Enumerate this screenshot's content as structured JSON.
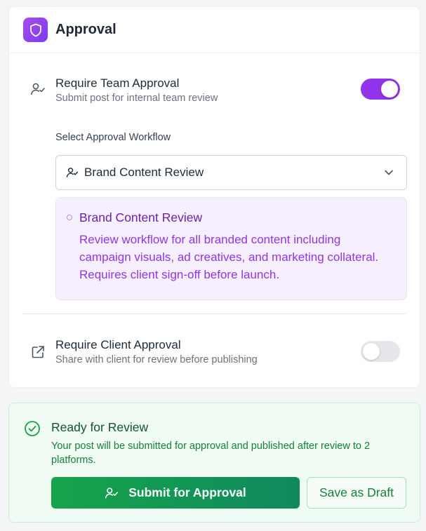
{
  "approval_card": {
    "title": "Approval",
    "team_approval": {
      "title": "Require Team Approval",
      "subtitle": "Submit post for internal team review",
      "enabled": true
    },
    "workflow": {
      "label": "Select Approval Workflow",
      "selected": "Brand Content Review",
      "info_title": "Brand Content Review",
      "info_description": "Review workflow for all branded content including campaign visuals, ad creatives, and marketing collateral. Requires client sign-off before launch."
    },
    "client_approval": {
      "title": "Require Client Approval",
      "subtitle": "Share with client for review before publishing",
      "enabled": false
    }
  },
  "ready_panel": {
    "title": "Ready for Review",
    "description": "Your post will be submitted for approval and published after review to 2 platforms.",
    "submit_label": "Submit for Approval",
    "draft_label": "Save as Draft"
  },
  "colors": {
    "accent_purple": "#9333ea",
    "success_green": "#16a34a"
  },
  "icons": {
    "header": "shield-icon",
    "team": "user-check-icon",
    "client": "external-link-icon",
    "ready": "check-circle-icon",
    "dropdown": "chevron-down-icon"
  }
}
